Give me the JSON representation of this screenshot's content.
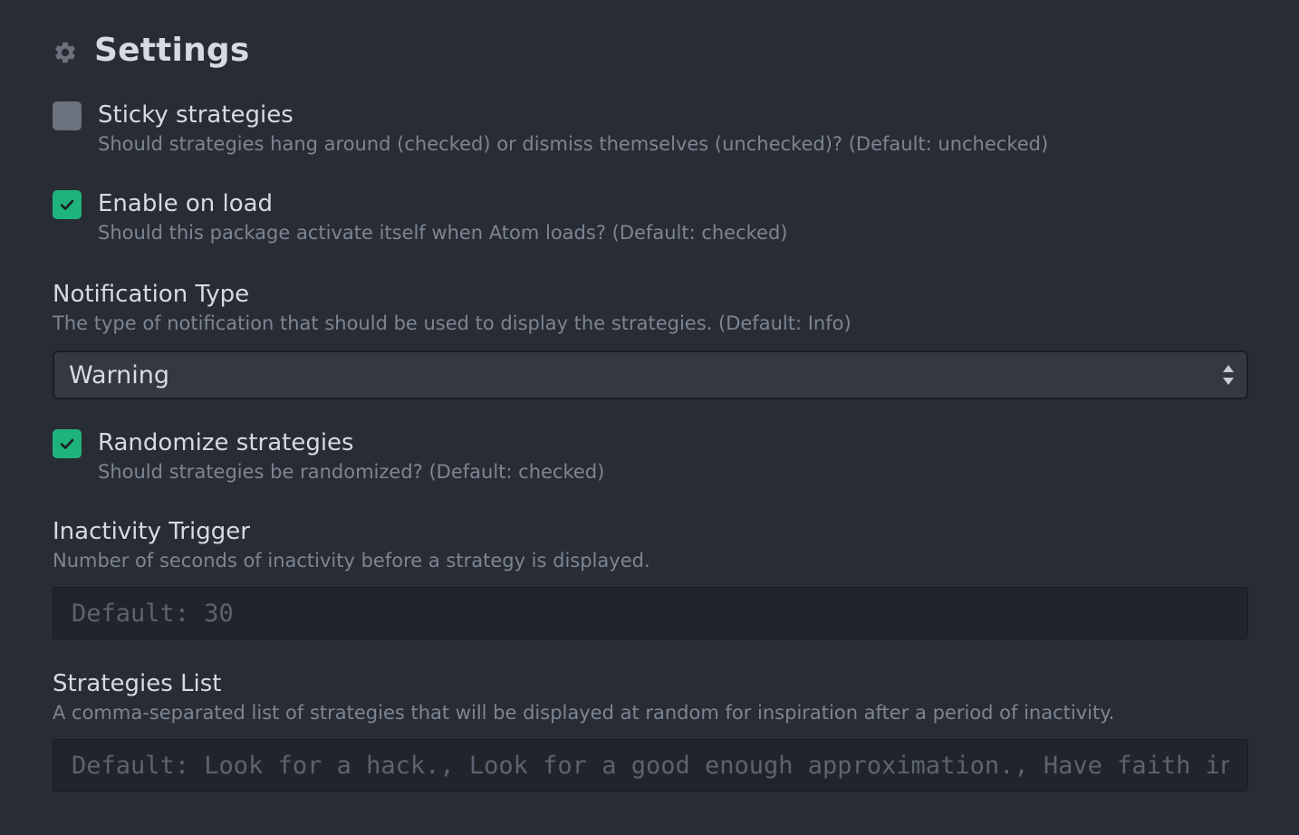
{
  "header": {
    "title": "Settings",
    "icon": "gear-icon"
  },
  "settings": {
    "sticky": {
      "title": "Sticky strategies",
      "description": "Should strategies hang around (checked) or dismiss themselves (unchecked)? (Default: unchecked)",
      "checked": false
    },
    "enable_on_load": {
      "title": "Enable on load",
      "description": "Should this package activate itself when Atom loads? (Default: checked)",
      "checked": true
    },
    "notification_type": {
      "title": "Notification Type",
      "description": "The type of notification that should be used to display the strategies. (Default: Info)",
      "selected": "Warning"
    },
    "randomize": {
      "title": "Randomize strategies",
      "description": "Should strategies be randomized? (Default: checked)",
      "checked": true
    },
    "inactivity_trigger": {
      "title": "Inactivity Trigger",
      "description": "Number of seconds of inactivity before a strategy is displayed.",
      "placeholder": "Default: 30"
    },
    "strategies_list": {
      "title": "Strategies List",
      "description": "A comma-separated list of strategies that will be displayed at random for inspiration after a period of inactivity.",
      "placeholder": "Default: Look for a hack., Look for a good enough approximation., Have faith in"
    }
  },
  "colors": {
    "background": "#282c34",
    "accent_checked": "#1fb37c",
    "checkbox_unchecked": "#6b717d",
    "title_text": "#d7dae0",
    "description_text": "#7d8593"
  }
}
